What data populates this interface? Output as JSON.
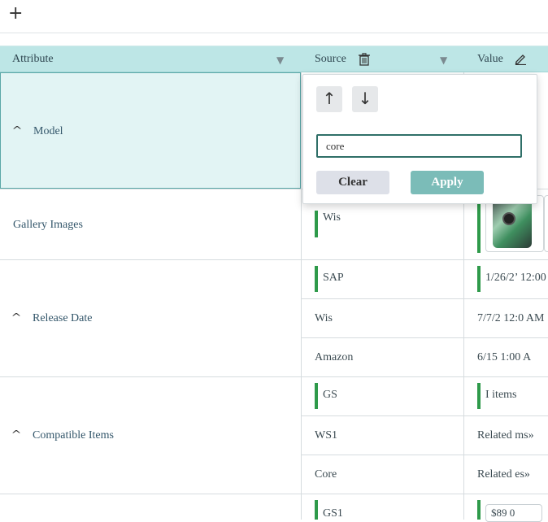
{
  "toolbar": {
    "add_label": "+"
  },
  "columns": {
    "attribute": "Attribute",
    "source": "Source",
    "value": "Value"
  },
  "rows": {
    "model": {
      "label": "Model"
    },
    "gallery": {
      "label": "Gallery Images",
      "source": "Wis"
    },
    "release": {
      "label": "Release Date",
      "sources": [
        "SAP",
        "Wis",
        "Amazon"
      ],
      "values": [
        "1/26/2’ 12:00",
        "7/7/2   12:0  AM",
        "6/15    1:00 A"
      ]
    },
    "compatible": {
      "label": "Compatible Items",
      "sources": [
        "GS",
        "WS1",
        "Core"
      ],
      "values": [
        "I     items",
        "Related   ms»",
        "Related   es»"
      ]
    },
    "price": {
      "source": "GS1",
      "value": "$89   0"
    }
  },
  "popup": {
    "sort_up_icon": "↑",
    "sort_down_icon": "↓",
    "filter_value": "core",
    "clear_label": "Clear",
    "apply_label": "Apply"
  },
  "colors": {
    "header": "#bde6e6",
    "accent_green": "#2e9a4a",
    "apply": "#7bbcb8",
    "selected": "#e2f4f4"
  }
}
